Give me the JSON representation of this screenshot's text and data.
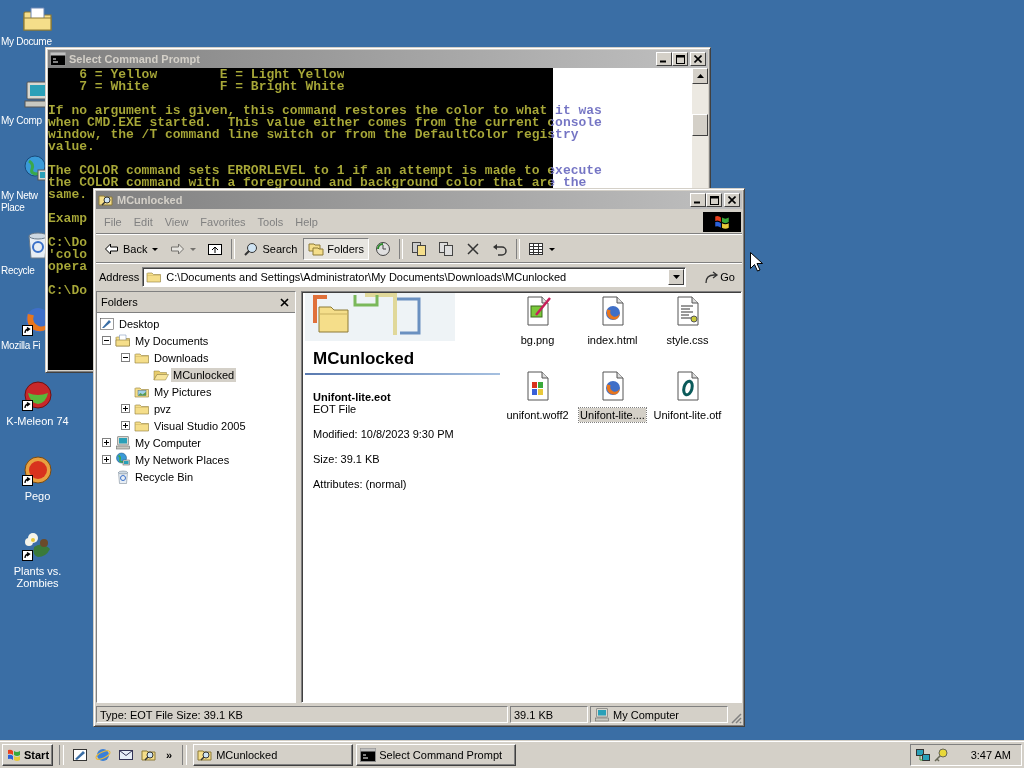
{
  "desktop_icons": [
    {
      "kind": "documents",
      "lines": [
        "My Docume"
      ],
      "shortcut": false
    },
    {
      "kind": "computer",
      "lines": [
        "My Comp"
      ],
      "shortcut": false
    },
    {
      "kind": "network",
      "lines": [
        "My Netw",
        "Place"
      ],
      "shortcut": false
    },
    {
      "kind": "recycle",
      "lines": [
        "Recycle"
      ],
      "shortcut": false
    },
    {
      "kind": "browser",
      "lines": [
        "Mozilla Fi"
      ],
      "shortcut": true
    },
    {
      "kind": "ball",
      "lines": [
        "K-Meleon 74"
      ],
      "shortcut": true
    },
    {
      "kind": "orb",
      "lines": [
        "Pego"
      ],
      "shortcut": true
    },
    {
      "kind": "flower",
      "lines": [
        "Plants vs.",
        "Zombies"
      ],
      "shortcut": true
    }
  ],
  "command_prompt": {
    "title": "Select Command Prompt",
    "active": false,
    "paragraphs": [
      [
        "    6 = Yellow        E = Light Yellow",
        "    7 = White         F = Bright White"
      ],
      [
        "If no argument is given, this command restores the color to what it was",
        "when CMD.EXE started.  This value either comes from the current console",
        "window, the /T command line switch or from the DefaultColor registry",
        "value."
      ],
      [
        "The COLOR command sets ERRORLEVEL to 1 if an attempt is made to execute",
        "the COLOR command with a foreground and background color that are the",
        "same."
      ],
      [
        "Examp"
      ],
      [
        "C:\\Do",
        "'colo",
        "opera"
      ],
      [
        "C:\\Do"
      ]
    ]
  },
  "explorer": {
    "title": "MCunlocked",
    "active": false,
    "menu": [
      "File",
      "Edit",
      "View",
      "Favorites",
      "Tools",
      "Help"
    ],
    "toolbar": [
      [
        {
          "kind": "back",
          "label": "Back",
          "dropdown": true,
          "pressed": false,
          "disabled": false
        },
        {
          "kind": "forward",
          "dropdown": true,
          "pressed": false,
          "disabled": true
        },
        {
          "kind": "up",
          "dropdown": false,
          "pressed": false,
          "disabled": false
        }
      ],
      [
        {
          "kind": "search",
          "label": "Search",
          "dropdown": false,
          "pressed": false,
          "disabled": false
        },
        {
          "kind": "folders",
          "label": "Folders",
          "dropdown": false,
          "pressed": true,
          "disabled": false
        },
        {
          "kind": "history",
          "dropdown": false,
          "pressed": false,
          "disabled": false
        }
      ],
      [
        {
          "kind": "move",
          "dropdown": false,
          "pressed": false,
          "disabled": false
        },
        {
          "kind": "copy",
          "dropdown": false,
          "pressed": false,
          "disabled": false
        },
        {
          "kind": "delete",
          "dropdown": false,
          "pressed": false,
          "disabled": false
        },
        {
          "kind": "undo",
          "dropdown": false,
          "pressed": false,
          "disabled": false
        }
      ],
      [
        {
          "kind": "views",
          "dropdown": true,
          "pressed": false,
          "disabled": false
        }
      ]
    ],
    "address": {
      "label": "Address",
      "value": "C:\\Documents and Settings\\Administrator\\My Documents\\Downloads\\MCunlocked",
      "go": "Go"
    },
    "folders_pane": {
      "title": "Folders",
      "tree": [
        {
          "label": "Desktop",
          "kind": "desktop",
          "selected": false,
          "children": [
            {
              "label": "My Documents",
              "kind": "documents",
              "expanded": true,
              "selected": false,
              "children": [
                {
                  "label": "Downloads",
                  "kind": "folder",
                  "expanded": true,
                  "selected": false,
                  "children": [
                    {
                      "label": "MCunlocked",
                      "kind": "openfolder",
                      "selected": true
                    }
                  ]
                },
                {
                  "label": "My Pictures",
                  "kind": "pictures",
                  "selected": false
                },
                {
                  "label": "pvz",
                  "kind": "folder",
                  "expanded": false,
                  "selected": false
                },
                {
                  "label": "Visual Studio 2005",
                  "kind": "folder",
                  "expanded": false,
                  "selected": false
                }
              ]
            },
            {
              "label": "My Computer",
              "kind": "computer",
              "expanded": false,
              "selected": false
            },
            {
              "label": "My Network Places",
              "kind": "network",
              "expanded": false,
              "selected": false
            },
            {
              "label": "Recycle Bin",
              "kind": "recycle",
              "selected": false
            }
          ]
        }
      ]
    },
    "details": {
      "folder_name": "MCunlocked",
      "file_name": "Unifont-lite.eot",
      "file_type": "EOT File",
      "modified": "Modified: 10/8/2023 9:30 PM",
      "size": "Size: 39.1 KB",
      "attributes": "Attributes: (normal)"
    },
    "files": [
      {
        "name": "bg.png",
        "kind": "image",
        "selected": false
      },
      {
        "name": "index.html",
        "kind": "web",
        "selected": false
      },
      {
        "name": "style.css",
        "kind": "text",
        "selected": false
      },
      {
        "name": "unifont.woff2",
        "kind": "winfile",
        "selected": false
      },
      {
        "name": "Unifont-lite....",
        "kind": "web",
        "selected": true
      },
      {
        "name": "Unifont-lite.otf",
        "kind": "font",
        "selected": false
      }
    ],
    "status_bar": {
      "description": "Type: EOT File Size: 39.1 KB",
      "size": "39.1 KB",
      "zone": "My Computer"
    }
  },
  "taskbar": {
    "start": "Start",
    "quick_launch": [
      {
        "kind": "desktop"
      },
      {
        "kind": "ie"
      },
      {
        "kind": "mail"
      },
      {
        "kind": "searchfolder"
      }
    ],
    "more": "»",
    "tasks": [
      {
        "kind": "explorer",
        "label": "MCunlocked",
        "selected": false
      },
      {
        "kind": "console",
        "label": "Select Command Prompt",
        "selected": false
      }
    ],
    "tray": [
      {
        "kind": "network"
      },
      {
        "kind": "key"
      }
    ],
    "clock": "3:47 AM"
  }
}
